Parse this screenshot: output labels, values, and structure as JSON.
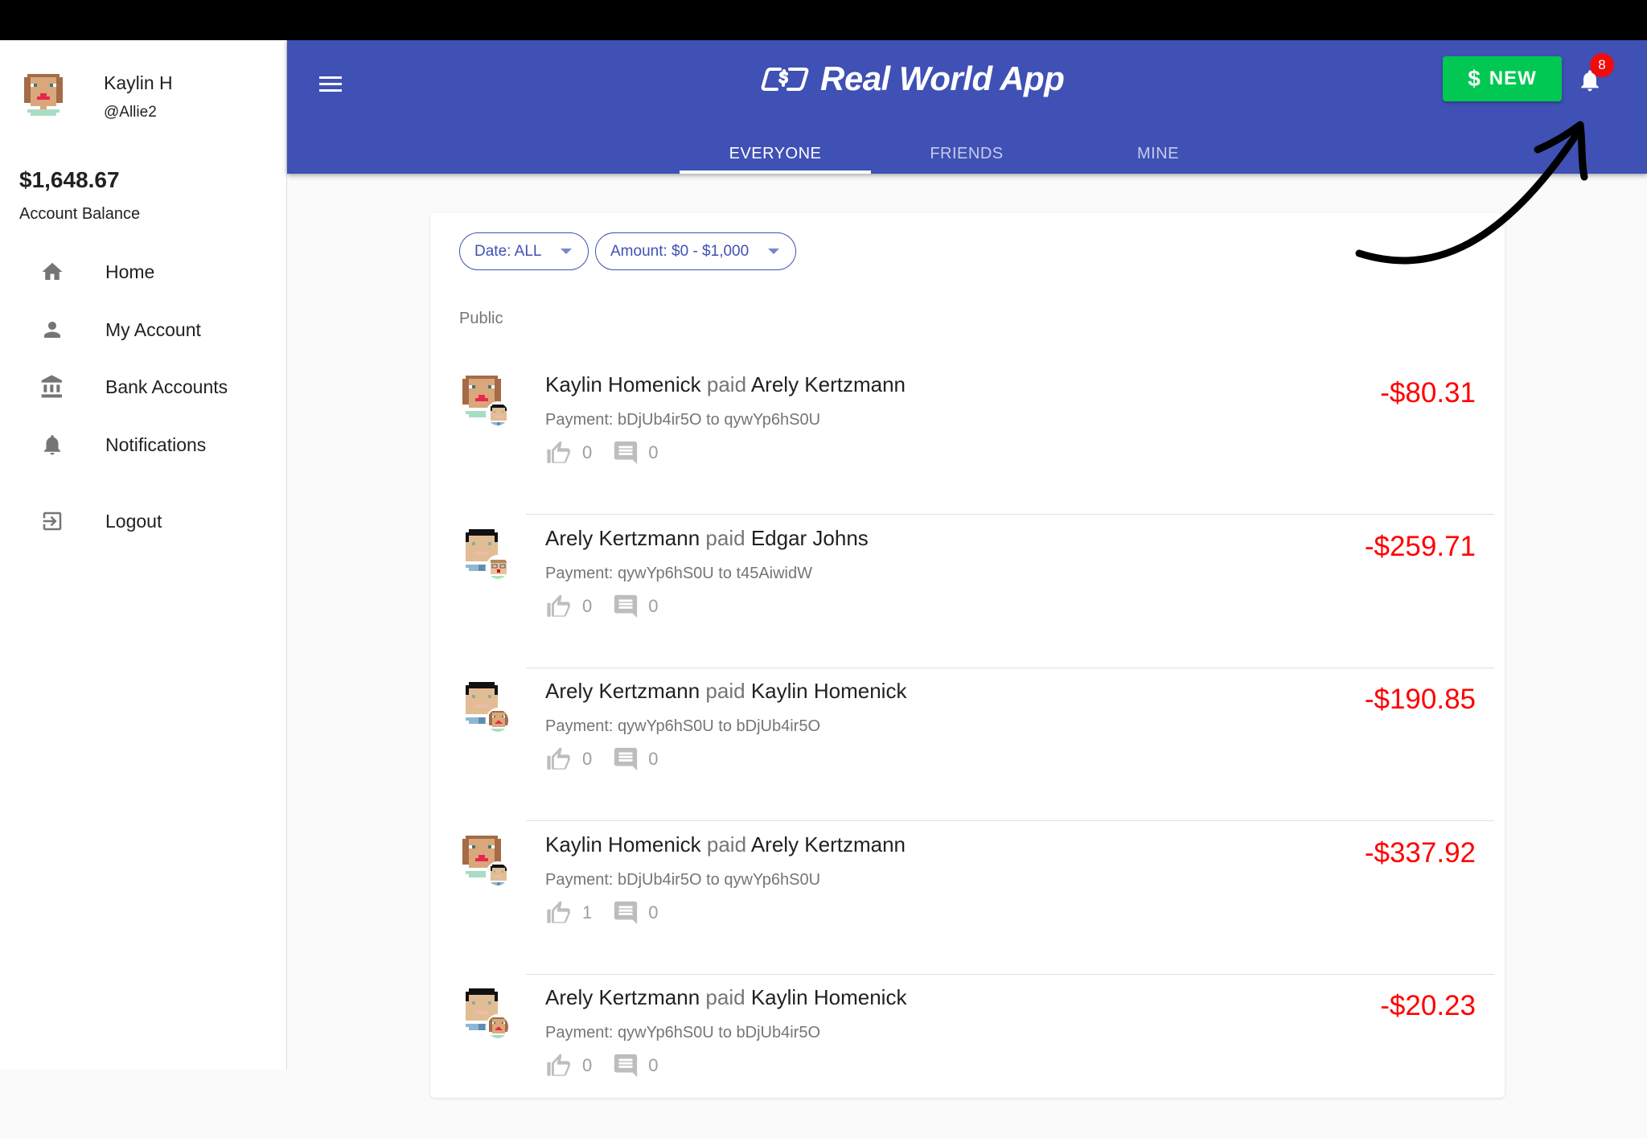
{
  "app": {
    "title": "Real World App"
  },
  "user": {
    "name": "Kaylin H",
    "handle": "@Allie2",
    "balance": "$1,648.67",
    "balance_label": "Account Balance"
  },
  "sidebar": {
    "items": [
      {
        "label": "Home",
        "icon": "home-icon"
      },
      {
        "label": "My Account",
        "icon": "person-icon"
      },
      {
        "label": "Bank Accounts",
        "icon": "bank-icon"
      },
      {
        "label": "Notifications",
        "icon": "bell-icon"
      },
      {
        "label": "Logout",
        "icon": "logout-icon"
      }
    ]
  },
  "header": {
    "new_button": {
      "icon": "$",
      "label": "NEW"
    },
    "notification_count": "8",
    "tabs": [
      {
        "label": "EVERYONE",
        "active": true
      },
      {
        "label": "FRIENDS",
        "active": false
      },
      {
        "label": "MINE",
        "active": false
      }
    ]
  },
  "filters": {
    "date": "Date: ALL",
    "amount": "Amount: $0 - $1,000"
  },
  "feed": {
    "section_label": "Public",
    "connector": "paid",
    "transactions": [
      {
        "sender": "Kaylin Homenick",
        "receiver": "Arely Kertzmann",
        "description": "Payment: bDjUb4ir5O to qywYp6hS0U",
        "likes": "0",
        "comments": "0",
        "amount": "-$80.31",
        "sender_avatar": "female",
        "receiver_avatar": "male"
      },
      {
        "sender": "Arely Kertzmann",
        "receiver": "Edgar Johns",
        "description": "Payment: qywYp6hS0U to t45AiwidW",
        "likes": "0",
        "comments": "0",
        "amount": "-$259.71",
        "sender_avatar": "male",
        "receiver_avatar": "male2"
      },
      {
        "sender": "Arely Kertzmann",
        "receiver": "Kaylin Homenick",
        "description": "Payment: qywYp6hS0U to bDjUb4ir5O",
        "likes": "0",
        "comments": "0",
        "amount": "-$190.85",
        "sender_avatar": "male",
        "receiver_avatar": "female"
      },
      {
        "sender": "Kaylin Homenick",
        "receiver": "Arely Kertzmann",
        "description": "Payment: bDjUb4ir5O to qywYp6hS0U",
        "likes": "1",
        "comments": "0",
        "amount": "-$337.92",
        "sender_avatar": "female",
        "receiver_avatar": "male"
      },
      {
        "sender": "Arely Kertzmann",
        "receiver": "Kaylin Homenick",
        "description": "Payment: qywYp6hS0U to bDjUb4ir5O",
        "likes": "0",
        "comments": "0",
        "amount": "-$20.23",
        "sender_avatar": "male",
        "receiver_avatar": "female"
      }
    ]
  },
  "colors": {
    "primary": "#3F51B5",
    "new_button": "#00C853",
    "badge": "#F20B0B",
    "amount_negative": "#FF0000"
  }
}
